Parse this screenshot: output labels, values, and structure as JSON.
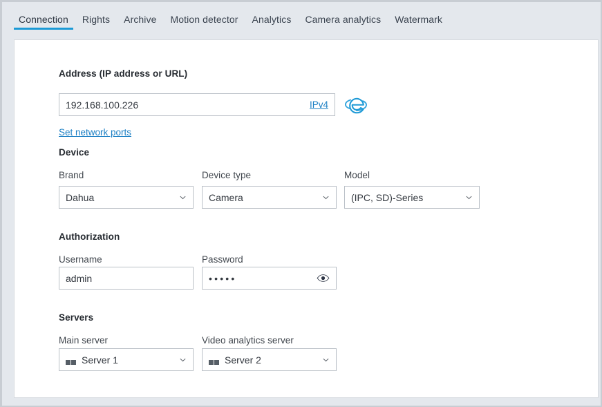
{
  "tabs": [
    {
      "label": "Connection",
      "active": true
    },
    {
      "label": "Rights",
      "active": false
    },
    {
      "label": "Archive",
      "active": false
    },
    {
      "label": "Motion detector",
      "active": false
    },
    {
      "label": "Analytics",
      "active": false
    },
    {
      "label": "Camera analytics",
      "active": false
    },
    {
      "label": "Watermark",
      "active": false
    }
  ],
  "address": {
    "heading": "Address (IP address or URL)",
    "value": "192.168.100.226",
    "ip_version_link": "IPv4",
    "network_ports_link": "Set network ports",
    "browser_icon": "internet-explorer-icon"
  },
  "device": {
    "heading": "Device",
    "brand": {
      "label": "Brand",
      "value": "Dahua"
    },
    "device_type": {
      "label": "Device type",
      "value": "Camera"
    },
    "model": {
      "label": "Model",
      "value": "(IPC, SD)-Series"
    }
  },
  "authorization": {
    "heading": "Authorization",
    "username": {
      "label": "Username",
      "value": "admin"
    },
    "password": {
      "label": "Password",
      "value": "•••••",
      "reveal_icon": "eye-icon"
    }
  },
  "servers": {
    "heading": "Servers",
    "main_server": {
      "label": "Main server",
      "value": "Server 1",
      "icon": "windows-icon"
    },
    "analytics_server": {
      "label": "Video analytics server",
      "value": "Server 2",
      "icon": "windows-icon"
    }
  },
  "colors": {
    "accent": "#1b9ad6",
    "link": "#1b7fc4",
    "header_bg": "#e4e8ed",
    "card_bg": "#ffffff",
    "border": "#b9bfc6",
    "text": "#33383f"
  }
}
